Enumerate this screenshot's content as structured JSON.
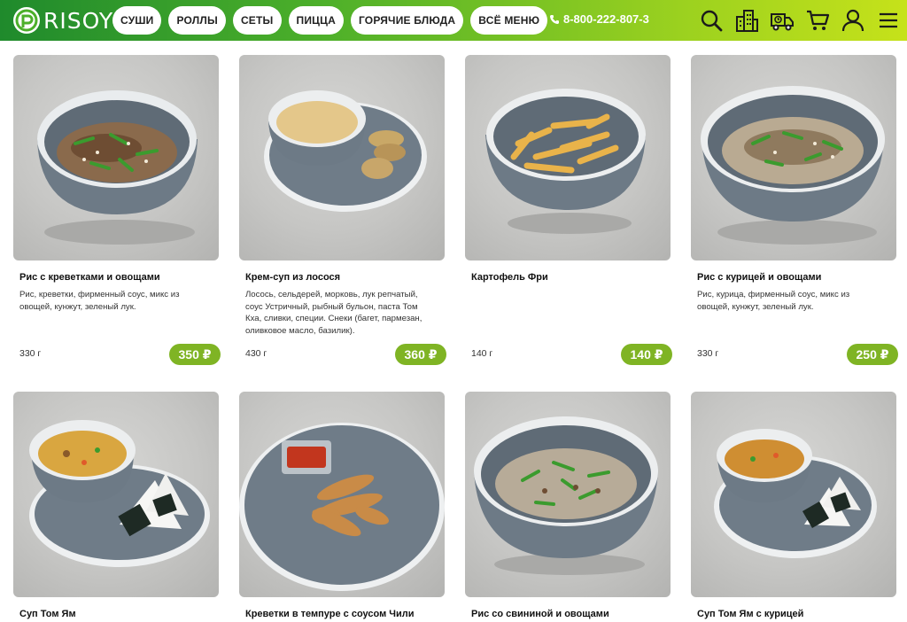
{
  "header": {
    "logo_text": "RISOY",
    "nav": [
      "СУШИ",
      "РОЛЛЫ",
      "СЕТЫ",
      "ПИЦЦА",
      "ГОРЯЧИЕ БЛЮДА",
      "ВСЁ МЕНЮ"
    ],
    "phone": "8-800-222-807-3",
    "icons": [
      "search-icon",
      "buildings-icon",
      "delivery-truck-icon",
      "cart-icon",
      "user-icon",
      "menu-icon"
    ]
  },
  "colors": {
    "accent": "#7fb424",
    "header_start": "#1f8a2c",
    "header_end": "#c6e21a"
  },
  "products": [
    {
      "name": "Рис с креветками и овощами",
      "desc": "Рис, креветки, фирменный соус, микс из овощей, кунжут, зеленый лук.",
      "weight": "330 г",
      "price": "350 ₽"
    },
    {
      "name": "Крем-суп из лосося",
      "desc": "Лосось, сельдерей, морковь, лук репчатый, соус Устричный, рыбный бульон, паста Том Кха, сливки, специи. Снеки (багет, пармезан, оливковое масло, базилик).",
      "weight": "430 г",
      "price": "360 ₽"
    },
    {
      "name": "Картофель Фри",
      "desc": "",
      "weight": "140 г",
      "price": "140 ₽"
    },
    {
      "name": "Рис с курицей и овощами",
      "desc": "Рис, курица, фирменный соус, микс из овощей, кунжут, зеленый лук.",
      "weight": "330 г",
      "price": "250 ₽"
    },
    {
      "name": "Суп Том Ям"
    },
    {
      "name": "Креветки в темпуре с соусом Чили"
    },
    {
      "name": "Рис со свининой и овощами"
    },
    {
      "name": "Суп Том Ям с курицей"
    }
  ]
}
